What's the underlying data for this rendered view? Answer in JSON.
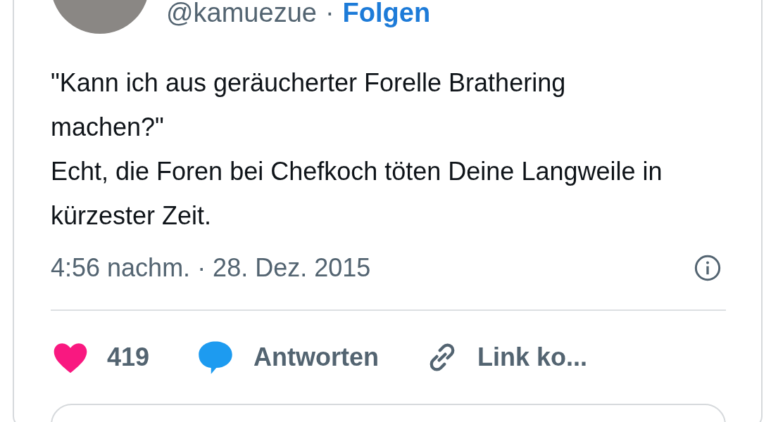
{
  "author": {
    "handle": "@kamuezue",
    "separator": "·",
    "follow": "Folgen"
  },
  "tweet": {
    "text": "\"Kann ich aus geräucherter Forelle Brathering machen?\"\nEcht, die Foren bei Chefkoch töten Deine Langweile in kürzester Zeit.",
    "timestamp": "4:56 nachm. · 28. Dez. 2015"
  },
  "actions": [
    {
      "kind": "like",
      "label": "419"
    },
    {
      "kind": "reply",
      "label": "Antworten"
    },
    {
      "kind": "link",
      "label": "Link ko..."
    }
  ]
}
